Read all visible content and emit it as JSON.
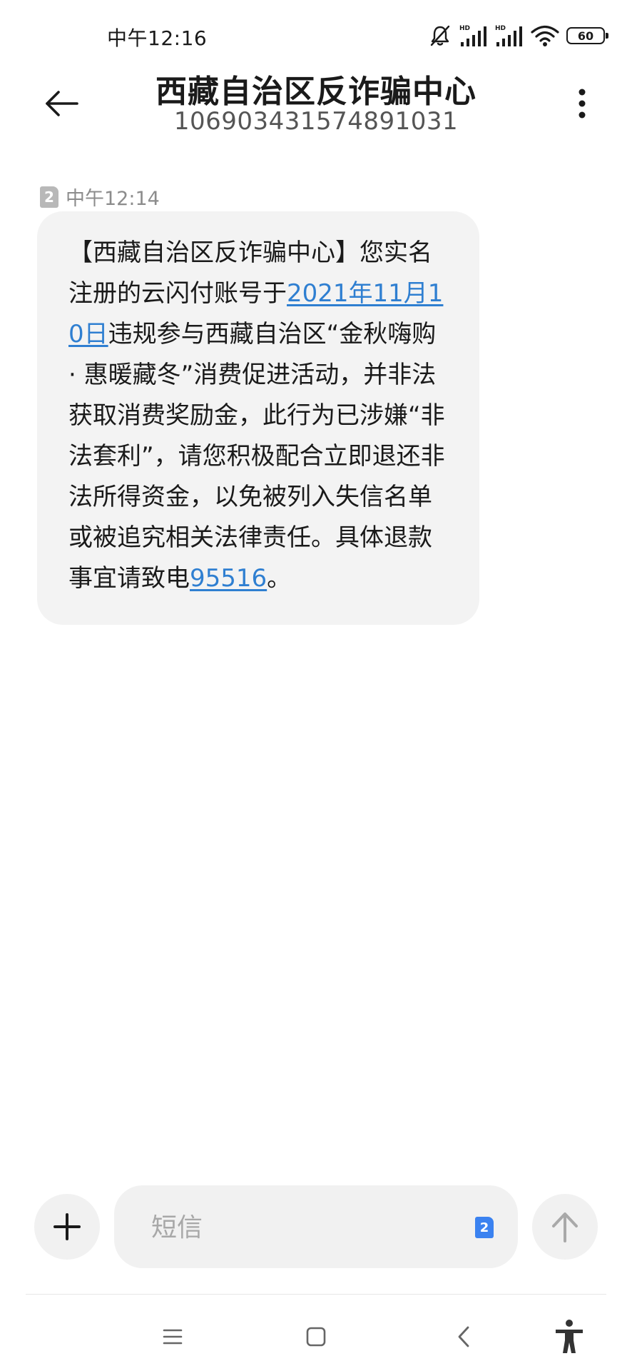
{
  "status_bar": {
    "time": "中午12:16",
    "battery": "60",
    "icons": [
      "mute-icon",
      "hd-signal-icon",
      "hd-signal-icon",
      "wifi-icon",
      "battery-icon"
    ]
  },
  "header": {
    "title": "西藏自治区反诈骗中心",
    "number": "106903431574891031",
    "back_icon": "arrow-left-icon",
    "more_icon": "more-vertical-icon"
  },
  "message": {
    "sim": "2",
    "time": "中午12:14",
    "text_part1": "【西藏自治区反诈骗中心】您实名注册的云闪付账号于",
    "link_date": "2021年11月10日",
    "text_part2": "违规参与西藏自治区“金秋嗨购 · 惠暖藏冬”消费促进活动，并非法获取消费奖励金，此行为已涉嫌“非法套利”，请您积极配合立即退还非法所得资金，以免被列入失信名单或被追究相关法律责任。具体退款事宜请致电",
    "link_phone": "95516",
    "text_part3": "。"
  },
  "compose": {
    "placeholder": "短信",
    "value": "",
    "sim": "2",
    "add_icon": "plus-icon",
    "send_icon": "arrow-up-icon"
  },
  "nav": {
    "icons": [
      "menu-icon",
      "home-square-icon",
      "back-chevron-icon",
      "accessibility-icon"
    ]
  },
  "colors": {
    "link": "#2f7fd1",
    "bubble": "#f3f3f3",
    "sim_active": "#3b82f0"
  }
}
